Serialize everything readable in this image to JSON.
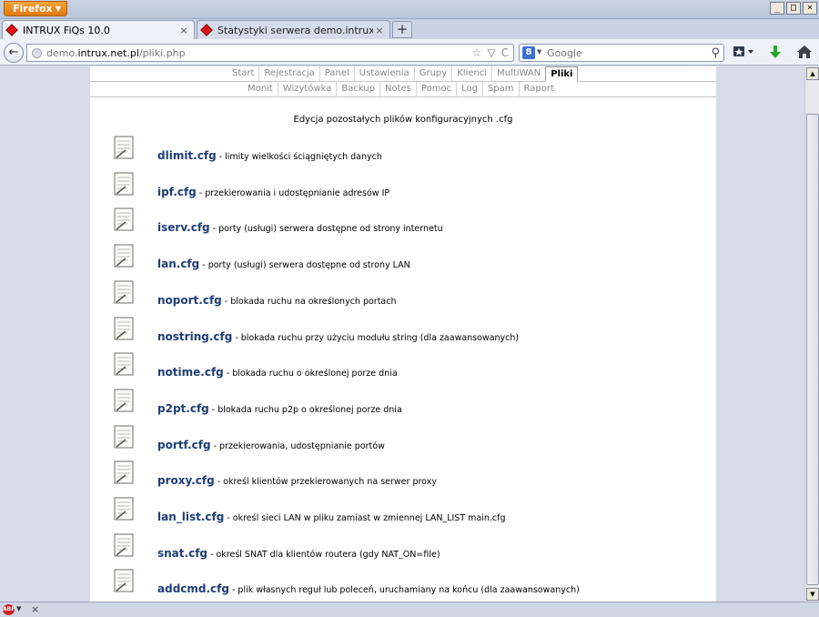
{
  "browser": {
    "menu_button": "Firefox",
    "window_controls": [
      "_",
      "□",
      "×"
    ],
    "tabs": [
      {
        "label": "INTRUX FiQs 10.0",
        "close": "×"
      },
      {
        "label": "Statystyki serwera demo.intrux.net.pl",
        "close": "×"
      }
    ],
    "new_tab": "+",
    "back_glyph": "←",
    "url_prefix": "demo.",
    "url_domain": "intrux.net.pl",
    "url_path": "/pliki.php",
    "url_controls": [
      "☆",
      "▽",
      "C"
    ],
    "search_engine": "8",
    "search_placeholder": "Google",
    "search_glyph": "⚲"
  },
  "menu": {
    "row1": [
      "Start",
      "Rejestracja",
      "Panel",
      "Ustawienia",
      "Grupy",
      "Klienci",
      "MultiWAN",
      "Pliki"
    ],
    "row1_active": "Pliki",
    "row2": [
      "Monit",
      "Wizytówka",
      "Backup",
      "Notes",
      "Pomoc",
      "Log",
      "Spam",
      "Raport"
    ]
  },
  "heading": "Edycja pozostałych plików konfiguracyjnych .cfg",
  "files": [
    {
      "name": "dlimit.cfg",
      "desc": "- limity wielkości ściągniętych danych"
    },
    {
      "name": "ipf.cfg",
      "desc": "- przekierowania i udostępnianie adresów IP"
    },
    {
      "name": "iserv.cfg",
      "desc": "- porty (usługi) serwera dostępne od strony internetu"
    },
    {
      "name": "lan.cfg",
      "desc": "- porty (usługi) serwera dostępne od strony LAN"
    },
    {
      "name": "noport.cfg",
      "desc": "- blokada ruchu na określonych portach"
    },
    {
      "name": "nostring.cfg",
      "desc": "- blokada ruchu przy użyciu modułu string (dla zaawansowanych)"
    },
    {
      "name": "notime.cfg",
      "desc": "- blokada ruchu o określonej porze dnia"
    },
    {
      "name": "p2pt.cfg",
      "desc": "- blokada ruchu p2p o określonej porze dnia"
    },
    {
      "name": "portf.cfg",
      "desc": "- przekierowania, udostępnianie portów"
    },
    {
      "name": "proxy.cfg",
      "desc": "- określ klientów przekierowanych na serwer proxy"
    },
    {
      "name": "lan_list.cfg",
      "desc": "- określ sieci LAN w pliku zamiast w zmiennej LAN_LIST main.cfg"
    },
    {
      "name": "snat.cfg",
      "desc": "- określ SNAT dla klientów routera (gdy NAT_ON=file)"
    },
    {
      "name": "addcmd.cfg",
      "desc": "- plik własnych reguł lub poleceń, uruchamiany na końcu (dla zaawansowanych)"
    }
  ],
  "statusbar": {
    "abp": "ABP",
    "close": "×"
  }
}
